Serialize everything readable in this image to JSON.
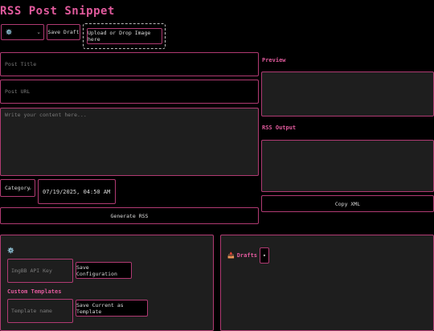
{
  "app": {
    "title": "RSS Post Snippet"
  },
  "toolbar": {
    "emoji_select_value": "⚙️",
    "save_draft_label": "Save Draft",
    "upload_label": "Upload or Drop Image here"
  },
  "form": {
    "post_title_placeholder": "Post Title",
    "post_url_placeholder": "Post URL",
    "content_placeholder": "Write your content here...",
    "category_value": "Category",
    "datetime_value": "07/19/2025, 04:50 AM",
    "generate_label": "Generate RSS"
  },
  "preview": {
    "label": "Preview"
  },
  "rss_output": {
    "label": "RSS Output",
    "copy_label": "Copy XML"
  },
  "config": {
    "icon": "⚙️",
    "api_key_placeholder": "ImgBB API Key",
    "save_config_label": "Save Configuration",
    "templates_heading": "Custom Templates",
    "template_name_placeholder": "Template name",
    "save_template_label": "Save Current as Template"
  },
  "drafts": {
    "icon": "📥",
    "label": "Drafts",
    "toggle": "▾"
  },
  "colors": {
    "accent": "#e05a9c",
    "border": "#b03a72",
    "panel": "#1e1e1e"
  }
}
